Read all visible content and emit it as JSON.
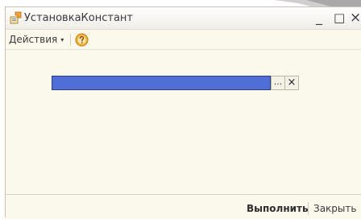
{
  "window": {
    "title": "УстановкаКонстант",
    "minimize_glyph": "_",
    "maximize_glyph": "□",
    "close_glyph": "×"
  },
  "toolbar": {
    "actions_label": "Действия",
    "actions_caret": "▾",
    "help_icon": "help-icon"
  },
  "form": {
    "value_field": "",
    "select_button_glyph": "...",
    "clear_button_glyph": "×"
  },
  "footer": {
    "execute_label": "Выполнить",
    "close_label": "Закрыть"
  },
  "colors": {
    "window_background": "#fbf8ec",
    "selected_field": "#4f6fd6",
    "help_icon_fill": "#f2b43b"
  }
}
